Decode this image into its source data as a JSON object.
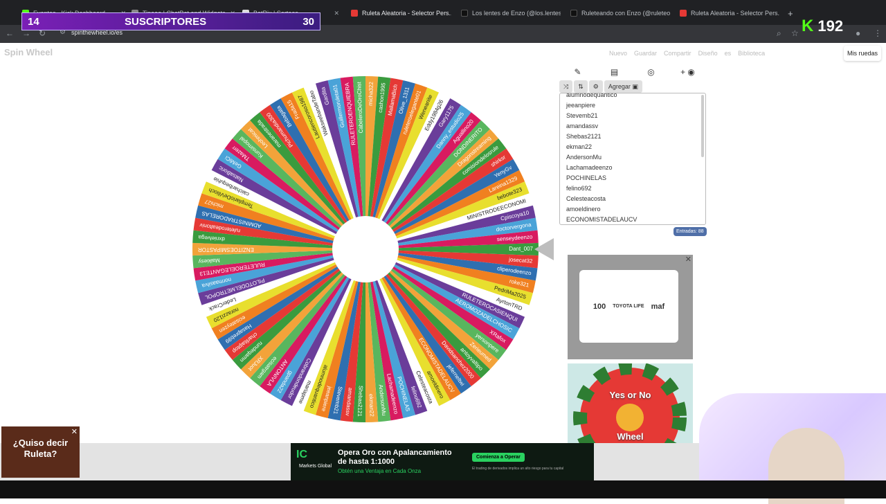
{
  "browser": {
    "tabs": [
      {
        "label": "Eventos · Kick Dashboard",
        "fav": "#53fc18"
      },
      {
        "label": "Tipeee | ChatBot and Widgets",
        "fav": "#888"
      },
      {
        "label": "BotRix | Sorteos",
        "fav": "#ddd"
      },
      {
        "label": "Ruleta Aleatoria - Selector Pers...",
        "fav": "#e53935"
      },
      {
        "label": "Los lentes de Enzo (@los.lentes...",
        "fav": "#111"
      },
      {
        "label": "Ruleteando con Enzo (@ruleteo...",
        "fav": "#111"
      },
      {
        "label": "Ruleta Aleatoria - Selector Pers...",
        "fav": "#e53935"
      }
    ],
    "url": "spinthewheel.io/es"
  },
  "overlay": {
    "left_num": "14",
    "label": "SUSCRIPTORES",
    "right_num": "30",
    "kick_count": "192",
    "kick_logo": "K"
  },
  "site": {
    "logo": "Spin Wheel",
    "menu": [
      "Nuevo",
      "Guardar",
      "Compartir",
      "Diseño",
      "es",
      "Biblioteca"
    ],
    "my_wheels": "Mis ruedas",
    "add_label": "Agregar",
    "entries_count": "Entradas: 88"
  },
  "entries": [
    "alumnodequantico",
    "jeeanpiere",
    "Stevemb21",
    "amandassv",
    "Shebas2121",
    "ekman22",
    "AndersonMu",
    "Lachamadeenzo",
    "POCHINELAS",
    "felino692",
    "Celesteacosta",
    "amoeldinero",
    "ECONOMISTADELAUCV"
  ],
  "wheel_labels": [
    "Dant_007",
    "josecat32",
    "cliperodeenzo",
    "roke321",
    "PedriMa2025",
    "AyrtonTRD",
    "RULETEROCASIENQUI",
    "AEROMOZADELCHOSIC",
    "XRafox",
    "yersonpere",
    "Zerieumed",
    "antoyvaltipo",
    "Davidsanchez2000",
    "jeferneltwi",
    "ECONOMISTADELAUCV",
    "amoeldinero",
    "Celesteacosta",
    "felino692",
    "POCHINELAS",
    "Lachamadeenzo",
    "AndersonMu",
    "ekman22",
    "Shebas2121",
    "amandassv",
    "Stevemb21",
    "jeeanpiere",
    "alumnodequantico",
    "mariapme",
    "Cobrandondeudor",
    "gpanda22",
    "ANTONIVLA",
    "ecisatrgam",
    "XRJuot",
    "rundeqamn",
    "charlitaiptop",
    "Hasapreb99",
    "ecisateyzen",
    "norazzi120",
    "LederCrack",
    "PILOTODELMETROPOL",
    "normaasilva",
    "RULETEROELEGANTE13",
    "Maikiesy",
    "ENZITOESMIPASTOR",
    "dxnielvega",
    "ruleterodealtoniv",
    "ADMINISTRADORELAS",
    "michi27",
    "TemplarioDeViliocho",
    "caicharibequhie",
    "NatsaBoric",
    "GeMiCi",
    "TMazerr",
    "Kunsimopal",
    "Leohmicat",
    "maranestrada",
    "Pichumandia300",
    "Bebagata",
    "Frada15",
    "Lautiencoroso1987",
    "WakseebandeTabo",
    "Gardita",
    "Guillermoruleta01",
    "RULETEROENQUIEBRA",
    "CabeleroDeOroChiste",
    "micha322",
    "cashon1995",
    "MallamaBich",
    "Olive_1311",
    "ruleteroelegante01",
    "Weneanite",
    "Eddy1984g26",
    "Gary1175",
    "Danny_estudio25",
    "Aguallino20",
    "DONDINERITO",
    "Dragonstreaming",
    "comisiondelosrule",
    "shirksr",
    "YenyGv",
    "Lareina1329",
    "bebote323",
    "MINISTRODEECONOMI",
    "Cpiscoya10",
    "doctorvergona",
    "senseydeenzo"
  ],
  "wheel_colors": [
    "#3a9b3e",
    "#e53935",
    "#2f6fb0",
    "#f08020",
    "#e8df2e",
    "#ffffff",
    "#6a3d9a",
    "#4aa3d8",
    "#d81b60",
    "#59b65e",
    "#f2a33a"
  ],
  "ads": {
    "ad1_text": [
      "100",
      "TOYOTA LIFE",
      "maf"
    ],
    "ad2_title_top": "Yes or No",
    "ad2_title_bottom": "Wheel"
  },
  "bottom_left": {
    "line1": "¿Quiso decir",
    "line2": "Ruleta?"
  },
  "banner": {
    "brand": "IC",
    "brand_sub": "Markets Global",
    "headline_1": "Opera Oro con Apalancamiento",
    "headline_2": "de hasta 1:1000",
    "sub": "Obtén una Ventaja en Cada Onza",
    "cta": "Comienza a Operar",
    "fine": "El trading de derivados implica un alto riesgo para tu capital"
  }
}
